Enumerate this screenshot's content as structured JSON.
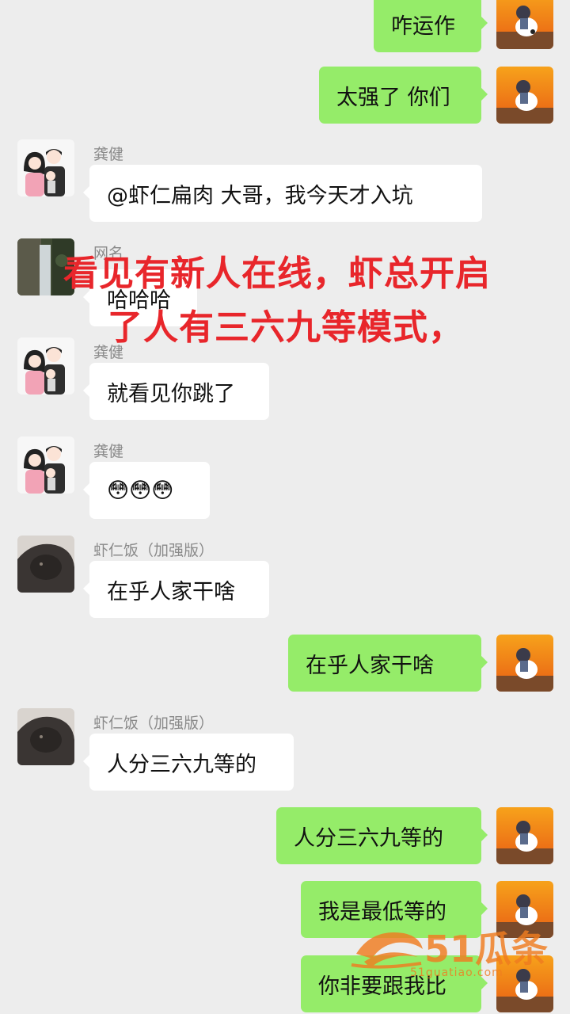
{
  "messages": [
    {
      "text": "咋运作"
    },
    {
      "text": "太强了 你们"
    },
    {
      "sender": "龚健",
      "text": "@虾仁扁肉  大哥，我今天才入坑"
    },
    {
      "sender": "网名",
      "text": "哈哈哈"
    },
    {
      "sender": "龚健",
      "text": "就看见你跳了"
    },
    {
      "sender": "龚健",
      "text": "😳😳😳"
    },
    {
      "sender": "虾仁饭（加强版）",
      "text": "在乎人家干啥"
    },
    {
      "text": "在乎人家干啥"
    },
    {
      "sender": "虾仁饭（加强版）",
      "text": "人分三六九等的"
    },
    {
      "text": "人分三六九等的"
    },
    {
      "text": "我是最低等的"
    },
    {
      "text": "你非要跟我比"
    }
  ],
  "overlay": {
    "line1": "看见有新人在线，虾总开启",
    "line2": "了人有三六九等模式，"
  },
  "watermark": {
    "brand": "51瓜条",
    "url": "51guatiao.com"
  },
  "colors": {
    "background": "#ededed",
    "bubble_self": "#95ec69",
    "bubble_other": "#ffffff",
    "overlay_text": "#e8262b",
    "watermark": "#f07c20"
  }
}
